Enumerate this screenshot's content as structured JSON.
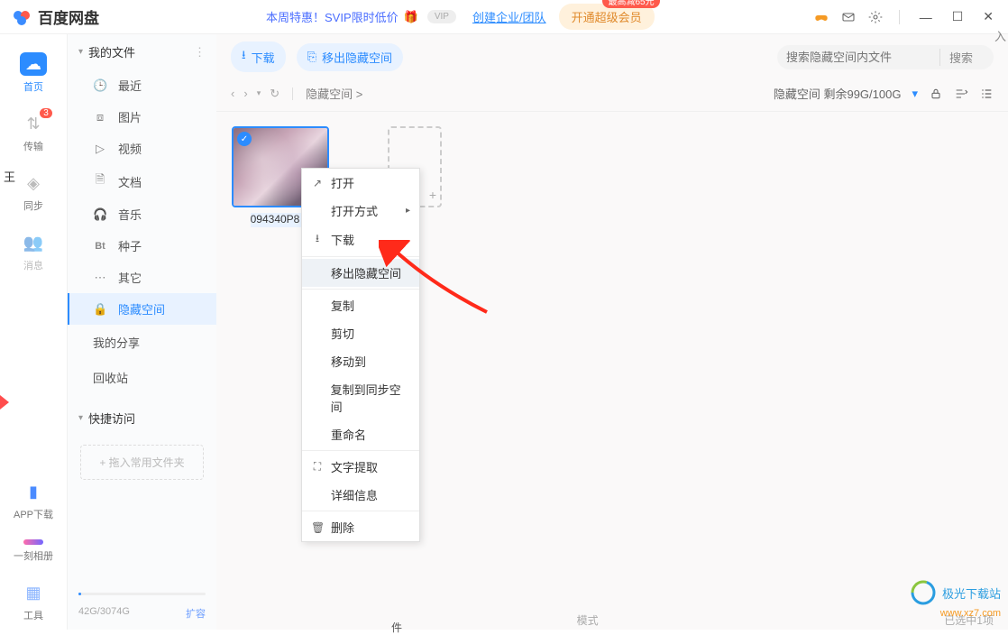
{
  "title": {
    "app_name": "百度网盘"
  },
  "promo": {
    "text": "本周特惠！SVIP限时低价",
    "vip_pill": "VIP",
    "team_link": "创建企业/团队",
    "open_vip": "开通超级会员",
    "discount": "最高减65元"
  },
  "window": {
    "min": "—",
    "max": "☐",
    "close": "✕"
  },
  "nav": [
    {
      "icon": "cloud",
      "label": "首页",
      "active": true
    },
    {
      "icon": "transfer",
      "label": "传输",
      "badge": "3"
    },
    {
      "icon": "sync",
      "label": "同步"
    },
    {
      "icon": "msg",
      "label": "消息",
      "dim": true
    }
  ],
  "nav_bottom": [
    {
      "icon": "phone",
      "label": "APP下载"
    },
    {
      "icon": "album",
      "label": "一刻相册"
    },
    {
      "icon": "tools",
      "label": "工具"
    }
  ],
  "sidebar": {
    "header": "我的文件",
    "items": [
      {
        "icon": "🕒",
        "label": "最近"
      },
      {
        "icon": "⧈",
        "label": "图片"
      },
      {
        "icon": "▷",
        "label": "视频"
      },
      {
        "icon": "🗎",
        "label": "文档"
      },
      {
        "icon": "🎧",
        "label": "音乐"
      },
      {
        "icon": "Bt",
        "label": "种子"
      },
      {
        "icon": "⋯",
        "label": "其它"
      },
      {
        "icon": "🔒",
        "label": "隐藏空间",
        "active": true
      }
    ],
    "share": "我的分享",
    "recycle": "回收站",
    "quick_header": "快捷访问",
    "quick_drop": "+ 拖入常用文件夹",
    "storage_used": "42G/3074G",
    "expand": "扩容"
  },
  "actions": {
    "download": "下载",
    "move_out": "移出隐藏空间"
  },
  "search": {
    "placeholder": "搜索隐藏空间内文件",
    "button": "搜索"
  },
  "path": {
    "crumb": "隐藏空间  >",
    "quota": "隐藏空间 剩余99G/100G"
  },
  "files": {
    "item1": "094340P8…",
    "drop": "件"
  },
  "ctx": {
    "open": "打开",
    "open_with": "打开方式",
    "download": "下载",
    "move_out": "移出隐藏空间",
    "copy": "复制",
    "cut": "剪切",
    "move_to": "移动到",
    "copy_sync": "复制到同步空间",
    "rename": "重命名",
    "ocr": "文字提取",
    "detail": "详细信息",
    "delete": "删除"
  },
  "status": {
    "selected": "已选中1项",
    "mode": "模式"
  },
  "watermark": {
    "text": "极光下载站",
    "url": "www.xz7.com"
  },
  "stray": {
    "left": "王",
    "right": "入"
  }
}
